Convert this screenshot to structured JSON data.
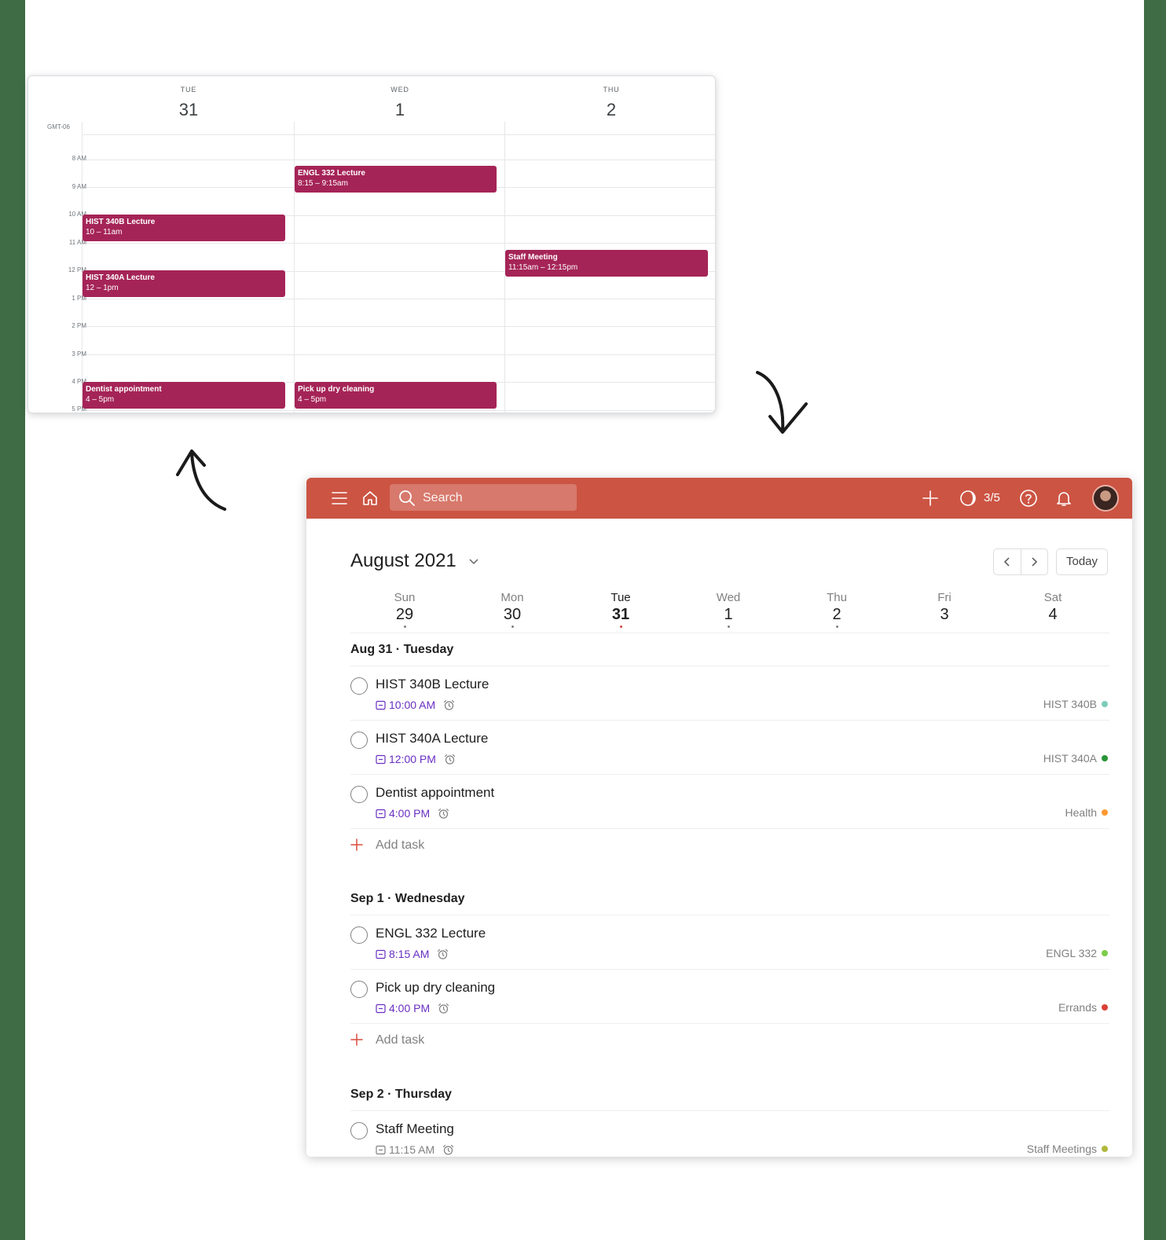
{
  "calendar": {
    "timezone": "GMT-06",
    "days": [
      {
        "dow": "TUE",
        "date": "31"
      },
      {
        "dow": "WED",
        "date": "1"
      },
      {
        "dow": "THU",
        "date": "2"
      }
    ],
    "hours": [
      "8 AM",
      "9 AM",
      "10 AM",
      "11 AM",
      "12 PM",
      "1 PM",
      "2 PM",
      "3 PM",
      "4 PM",
      "5 PM"
    ],
    "events": [
      {
        "title": "ENGL 332 Lecture",
        "time": "8:15 – 9:15am"
      },
      {
        "title": "HIST 340B Lecture",
        "time": "10 – 11am"
      },
      {
        "title": "Staff Meeting",
        "time": "11:15am – 12:15pm"
      },
      {
        "title": "HIST 340A Lecture",
        "time": "12 – 1pm"
      },
      {
        "title": "Dentist appointment",
        "time": "4 – 5pm"
      },
      {
        "title": "Pick up dry cleaning",
        "time": "4 – 5pm"
      }
    ],
    "event_color": "#a52457"
  },
  "app": {
    "topbar_color": "#cc5443",
    "search_placeholder": "Search",
    "karma": "3/5",
    "month_title": "August 2021",
    "today_label": "Today",
    "week": [
      {
        "name": "Sun",
        "date": "29"
      },
      {
        "name": "Mon",
        "date": "30"
      },
      {
        "name": "Tue",
        "date": "31"
      },
      {
        "name": "Wed",
        "date": "1"
      },
      {
        "name": "Thu",
        "date": "2"
      },
      {
        "name": "Fri",
        "date": "3"
      },
      {
        "name": "Sat",
        "date": "4"
      }
    ],
    "add_task_label": "Add task",
    "sections": [
      {
        "title": "Aug 31 · Tuesday",
        "tasks": [
          {
            "name": "HIST 340B Lecture",
            "time": "10:00 AM",
            "project": "HIST 340B",
            "color": "#7ecbb9"
          },
          {
            "name": "HIST 340A Lecture",
            "time": "12:00 PM",
            "project": "HIST 340A",
            "color": "#299438"
          },
          {
            "name": "Dentist appointment",
            "time": "4:00 PM",
            "project": "Health",
            "color": "#ff9933"
          }
        ]
      },
      {
        "title": "Sep 1 · Wednesday",
        "tasks": [
          {
            "name": "ENGL 332 Lecture",
            "time": "8:15 AM",
            "project": "ENGL 332",
            "color": "#7ecc49"
          },
          {
            "name": "Pick up dry cleaning",
            "time": "4:00 PM",
            "project": "Errands",
            "color": "#db4035"
          }
        ]
      },
      {
        "title": "Sep 2 · Thursday",
        "tasks": [
          {
            "name": "Staff Meeting",
            "time": "11:15 AM",
            "project": "Staff Meetings",
            "color": "#afb83b"
          }
        ]
      }
    ]
  }
}
